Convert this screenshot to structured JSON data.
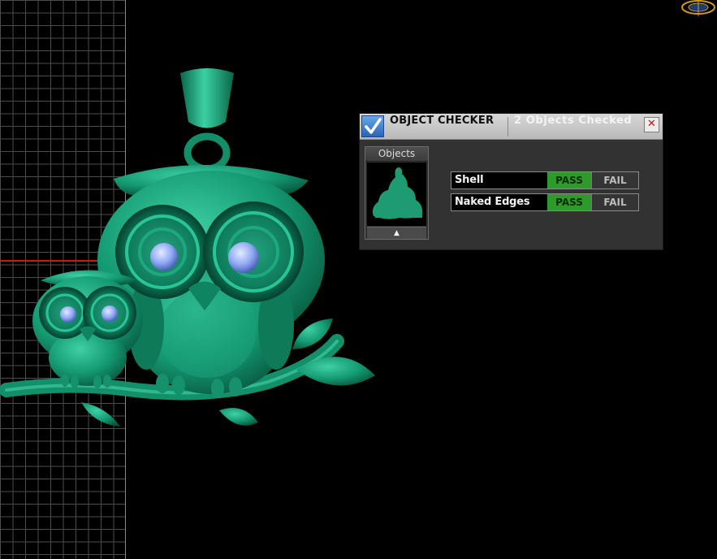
{
  "viewport": {
    "background": "#000000",
    "grid_color": "#5a5a5a",
    "axis_color": "#c41a1a",
    "model": {
      "description_icon": "owl-pendant-model-icon",
      "material_color": "#1f9b74",
      "gem_color": "#8fa8f4"
    },
    "corner_widget_icon": "orientation-widget-icon"
  },
  "object_checker": {
    "title": "OBJECT CHECKER",
    "objects_checked": "2  Objects Checked",
    "close_icon": "close-icon",
    "logo_icon": "checkmark-icon",
    "objects_label": "Objects",
    "scroll_up": "▲",
    "rows": [
      {
        "name": "Shell",
        "pass": "PASS",
        "fail": "FAIL",
        "result": "pass"
      },
      {
        "name": "Naked Edges",
        "pass": "PASS",
        "fail": "FAIL",
        "result": "pass"
      }
    ],
    "pass_color": "#2e9a2a",
    "fail_color": "#343434"
  }
}
